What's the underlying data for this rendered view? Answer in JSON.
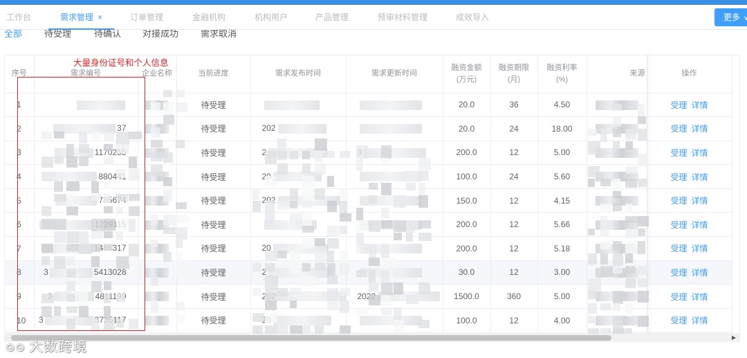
{
  "nav": {
    "tabs": [
      {
        "label": "工作台",
        "active": false
      },
      {
        "label": "需求管理",
        "active": true,
        "closable": true
      },
      {
        "label": "订单管理",
        "active": false
      },
      {
        "label": "金融机构",
        "active": false
      },
      {
        "label": "机构用户",
        "active": false
      },
      {
        "label": "产品管理",
        "active": false
      },
      {
        "label": "预审材料管理",
        "active": false
      },
      {
        "label": "成效导入",
        "active": false
      }
    ],
    "close_glyph": "×",
    "more_label": "更多",
    "more_icon": "chevron-down-icon"
  },
  "status_tabs": [
    "全部",
    "待受理",
    "待确认",
    "对接成功",
    "需求取消"
  ],
  "table": {
    "headers": {
      "seq": "序号",
      "demand_no": "需求编号",
      "company": "企业名称",
      "progress": "当前进度",
      "published": "需求发布时间",
      "updated": "需求更新时间",
      "amount": [
        "融资金额",
        "(万元)"
      ],
      "term": [
        "融资期限",
        "(月)"
      ],
      "rate": [
        "融资利率",
        "(%)"
      ],
      "source": "来源",
      "action": "操作"
    },
    "rows": [
      {
        "seq": "1",
        "demand_tail": "",
        "progress": "待受理",
        "published": "",
        "updated": "",
        "amount": "20.0",
        "term": "36",
        "rate": "4.50"
      },
      {
        "seq": "2",
        "demand_tail": "37",
        "progress": "待受理",
        "published": "202",
        "updated": "",
        "amount": "20.0",
        "term": "24",
        "rate": "18.00"
      },
      {
        "seq": "3",
        "demand_tail": "1170255",
        "progress": "待受理",
        "published": "2",
        "updated": "3",
        "amount": "200.0",
        "term": "12",
        "rate": "5.00"
      },
      {
        "seq": "4",
        "demand_tail": "880441",
        "progress": "待受理",
        "published": "20",
        "updated": "",
        "amount": "100.0",
        "term": "24",
        "rate": "5.60"
      },
      {
        "seq": "5",
        "demand_tail": "785674",
        "progress": "待受理",
        "published": "202",
        "updated": "",
        "amount": "150.0",
        "term": "12",
        "rate": "4.15"
      },
      {
        "seq": "6",
        "demand_tail": "1229115",
        "progress": "待受理",
        "published": "",
        "updated": "",
        "amount": "200.0",
        "term": "12",
        "rate": "5.66"
      },
      {
        "seq": "7",
        "demand_tail": "1486317",
        "progress": "待受理",
        "published": "20",
        "updated": "",
        "amount": "200.0",
        "term": "12",
        "rate": "5.18"
      },
      {
        "seq": "8",
        "demand_head": "3",
        "demand_tail": "5413028",
        "progress": "待受理",
        "published": "2",
        "updated": "",
        "amount": "30.0",
        "term": "12",
        "rate": "3.00"
      },
      {
        "seq": "9",
        "demand_head": "3",
        "demand_tail": "4811199",
        "progress": "待受理",
        "published": "202",
        "updated": "2022",
        "amount": "1500.0",
        "term": "360",
        "rate": "5.00"
      },
      {
        "seq": "10",
        "demand_head": "3",
        "demand_tail": "3735117",
        "progress": "待受理",
        "published": "20",
        "updated": "",
        "amount": "100.0",
        "term": "12",
        "rate": "4.00"
      }
    ],
    "action_links": {
      "accept": "受理",
      "detail": "详情"
    },
    "highlight_row": 8
  },
  "annotation": {
    "text": "大量身份证号和个人信息",
    "color": "#e0242b"
  },
  "watermark": {
    "text": "大数跨境",
    "icon": "logo-icon"
  },
  "colors": {
    "accent": "#409eff",
    "topbar": "#3a8ee6",
    "annotation": "#e0242b",
    "header_text": "#909399"
  }
}
